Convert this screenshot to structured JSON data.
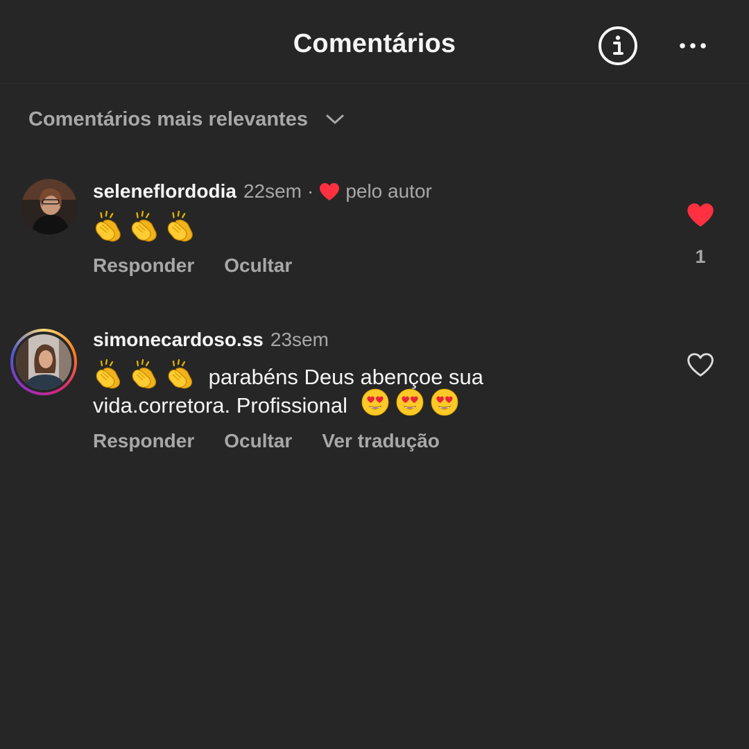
{
  "header": {
    "title": "Comentários",
    "info_icon": "info-circle-icon",
    "more_icon": "more-horizontal-icon"
  },
  "sort": {
    "label": "Comentários mais relevantes",
    "icon": "chevron-down-icon"
  },
  "comments": [
    {
      "username": "seleneflordodia",
      "time": "22sem",
      "separator": "·",
      "liked_by_author_label": "pelo autor",
      "text_emojis": [
        "clapping-hands",
        "clapping-hands",
        "clapping-hands"
      ],
      "actions": [
        "Responder",
        "Ocultar"
      ],
      "liked": true,
      "like_count": "1"
    },
    {
      "username": "simonecardoso.ss",
      "time": "23sem",
      "text_line1": "parabéns Deus abençoe sua",
      "text_line2": "vida.corretora. Profissional",
      "leading_emojis": [
        "clapping-hands",
        "clapping-hands",
        "clapping-hands"
      ],
      "trailing_emojis": [
        "heart-eyes",
        "heart-eyes",
        "heart-eyes"
      ],
      "actions": [
        "Responder",
        "Ocultar",
        "Ver tradução"
      ],
      "liked": false,
      "has_story_ring": true
    }
  ],
  "colors": {
    "background": "#262626",
    "text_primary": "#f5f5f5",
    "text_secondary": "#a8a8a8",
    "like_red": "#ff3040"
  }
}
